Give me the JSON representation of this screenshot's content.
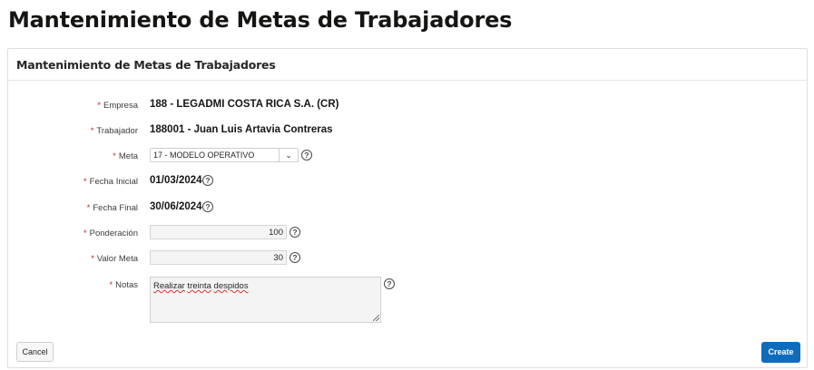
{
  "page": {
    "title": "Mantenimiento de Metas de Trabajadores"
  },
  "region": {
    "title": "Mantenimiento de Metas de Trabajadores"
  },
  "form": {
    "required_marker": "*",
    "empresa": {
      "label": "Empresa",
      "value": "188 - LEGADMI COSTA RICA S.A. (CR)"
    },
    "trabajador": {
      "label": "Trabajador",
      "value": "188001 - Juan Luis Artavia Contreras"
    },
    "meta": {
      "label": "Meta",
      "value": "17 - MODELO OPERATIVO",
      "help": "?"
    },
    "fecha_inicial": {
      "label": "Fecha Inicial",
      "value": "01/03/2024",
      "help": "?"
    },
    "fecha_final": {
      "label": "Fecha Final",
      "value": "30/06/2024",
      "help": "?"
    },
    "ponderacion": {
      "label": "Ponderación",
      "value": "100",
      "help": "?"
    },
    "valor_meta": {
      "label": "Valor Meta",
      "value": "30",
      "help": "?"
    },
    "notas": {
      "label": "Notas",
      "value_word1": "Realizar",
      "value_word2": "treinta",
      "value_word3": "despidos",
      "help": "?"
    }
  },
  "buttons": {
    "cancel": "Cancel",
    "create": "Create"
  },
  "icons": {
    "select_toggle": "chevron-down-icon",
    "help": "help-circle-icon"
  },
  "colors": {
    "primary_button": "#0f6cbd",
    "required": "#c1272d"
  }
}
